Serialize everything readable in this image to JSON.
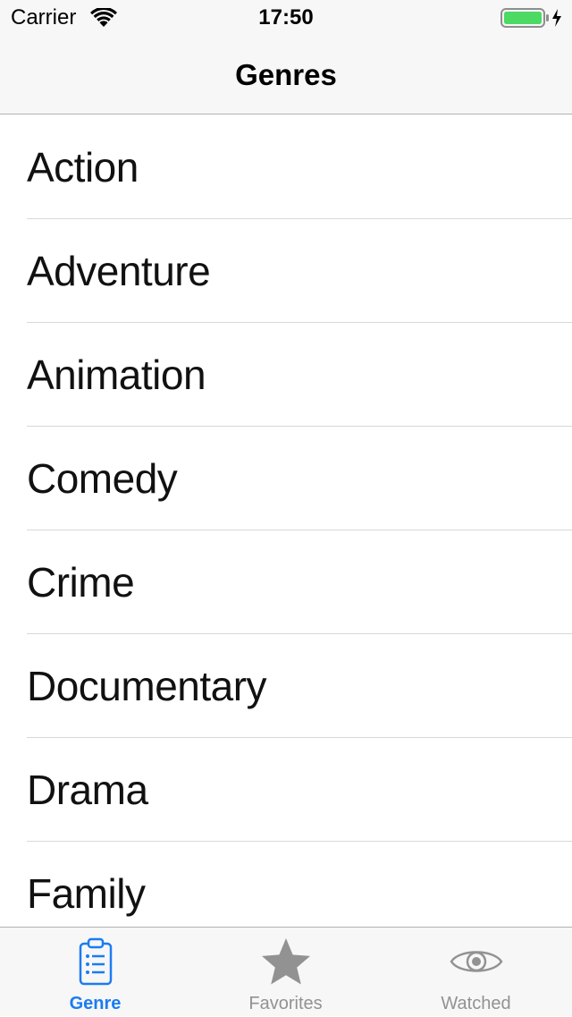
{
  "status_bar": {
    "carrier": "Carrier",
    "time": "17:50",
    "wifi_icon": "wifi-icon",
    "battery_icon": "battery-charging-icon",
    "battery_color": "#4cd964"
  },
  "nav": {
    "title": "Genres"
  },
  "genres": [
    {
      "label": "Action"
    },
    {
      "label": "Adventure"
    },
    {
      "label": "Animation"
    },
    {
      "label": "Comedy"
    },
    {
      "label": "Crime"
    },
    {
      "label": "Documentary"
    },
    {
      "label": "Drama"
    },
    {
      "label": "Family"
    }
  ],
  "tabs": [
    {
      "label": "Genre",
      "icon": "clipboard-list-icon",
      "active": true
    },
    {
      "label": "Favorites",
      "icon": "star-icon",
      "active": false
    },
    {
      "label": "Watched",
      "icon": "eye-icon",
      "active": false
    }
  ],
  "colors": {
    "accent": "#1a7cf2",
    "inactive_tab": "#929292"
  }
}
